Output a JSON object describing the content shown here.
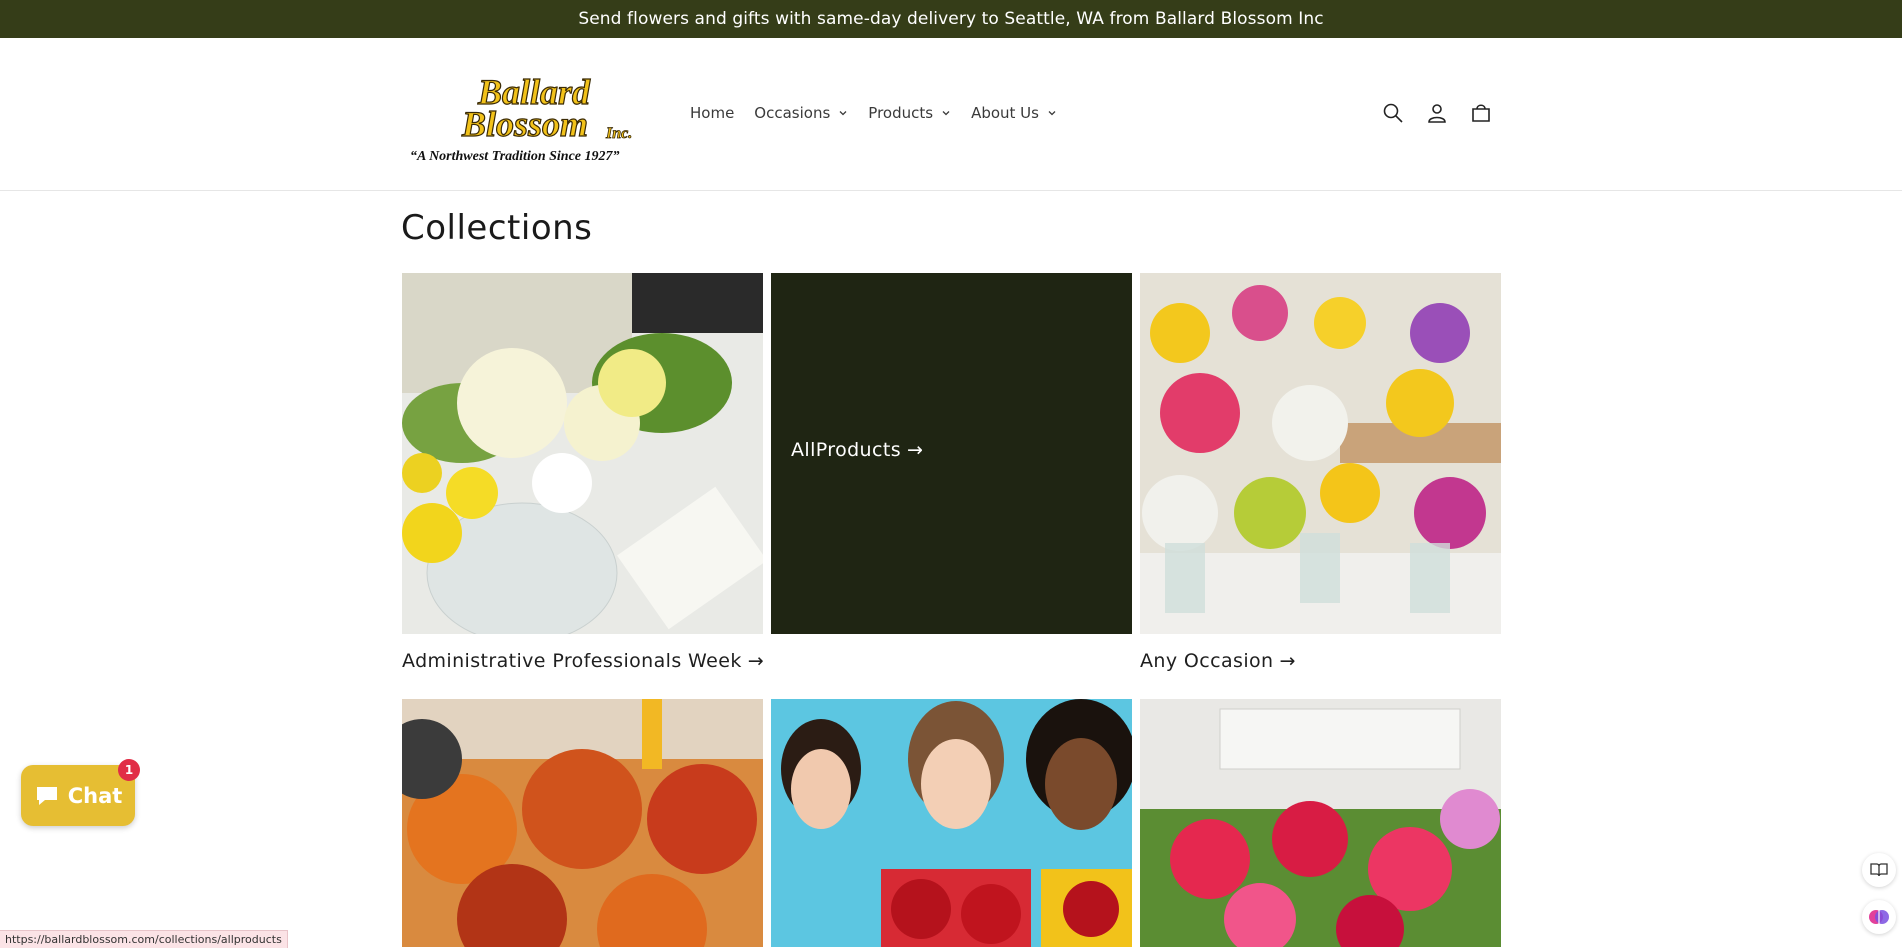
{
  "announcement": "Send flowers and gifts with same-day delivery to Seattle, WA from Ballard Blossom Inc",
  "logo": {
    "line1": "Ballard",
    "line2": "Blossom",
    "suffix": "Inc.",
    "tagline": "“A Northwest Tradition Since 1927”"
  },
  "nav": {
    "items": [
      {
        "label": "Home",
        "has_dropdown": false
      },
      {
        "label": "Occasions",
        "has_dropdown": true
      },
      {
        "label": "Products",
        "has_dropdown": true
      },
      {
        "label": "About Us",
        "has_dropdown": true
      }
    ]
  },
  "header_icons": [
    "search-icon",
    "account-icon",
    "cart-icon"
  ],
  "page_title": "Collections",
  "collections": [
    {
      "label": "Administrative Professionals Week",
      "arrow": "→"
    },
    {
      "label": "AllProducts",
      "arrow": "→"
    },
    {
      "label": "Any Occasion",
      "arrow": "→"
    }
  ],
  "chat": {
    "label": "Chat",
    "badge": "1"
  },
  "status_url": "https://ballardblossom.com/collections/allproducts",
  "colors": {
    "announcement_bg": "#353d18",
    "dark_card_bg": "#1f2513",
    "chat_bg": "#e6be33",
    "badge_bg": "#e12d46",
    "logo_gold": "#f2c21a"
  }
}
